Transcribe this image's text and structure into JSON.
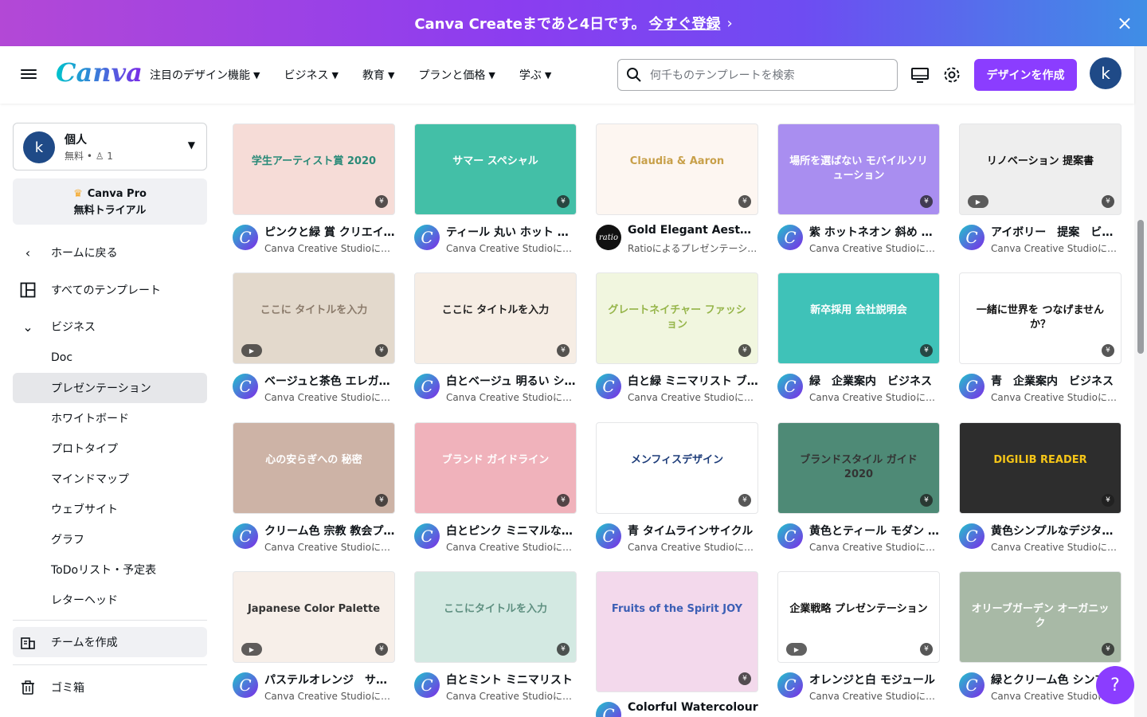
{
  "banner": {
    "text": "Canva Createまであと4日です。",
    "cta": "今すぐ登録",
    "chevron": "›",
    "close": "×"
  },
  "header": {
    "logo": "Canva",
    "nav": [
      {
        "label": "注目のデザイン機能"
      },
      {
        "label": "ビジネス"
      },
      {
        "label": "教育"
      },
      {
        "label": "プランと価格"
      },
      {
        "label": "学ぶ"
      }
    ],
    "search_placeholder": "何千ものテンプレートを検索",
    "create_button": "デザインを作成",
    "avatar_letter": "k"
  },
  "sidebar": {
    "account": {
      "avatar": "k",
      "name": "個人",
      "plan": "無料 • ♙ 1"
    },
    "pro": {
      "line1": "Canva Pro",
      "line2": "無料トライアル"
    },
    "back": "ホームに戻る",
    "all_templates": "すべてのテンプレート",
    "business": "ビジネス",
    "sub_items": [
      "Doc",
      "プレゼンテーション",
      "ホワイトボード",
      "プロトタイプ",
      "マインドマップ",
      "ウェブサイト",
      "グラフ",
      "ToDoリスト・予定表",
      "レターヘッド"
    ],
    "team": "チームを作成",
    "trash": "ゴミ箱"
  },
  "templates": [
    {
      "title": "ピンクと緑 賞 クリエイティブ",
      "by": "Canva Creative Studioによる",
      "thumb_text": "学生アーティスト賞 2020",
      "bg": "#f6dcd7",
      "fg": "#2a8a78",
      "video": false
    },
    {
      "title": "ティール 丸い ホット ネオン",
      "by": "Canva Creative Studioによる",
      "thumb_text": "サマー スペシャル",
      "bg": "#43bfa7",
      "fg": "#ffffff",
      "video": false
    },
    {
      "title": "Gold Elegant Aesthetic",
      "by": "Ratioによるプレゼンテーション",
      "thumb_text": "Claudia & Aaron",
      "bg": "#fdf6f1",
      "fg": "#c8a04a",
      "video": false
    },
    {
      "title": "紫 ホットネオン 斜め モバイル",
      "by": "Canva Creative Studioによる",
      "thumb_text": "場所を選ばない モバイルソリューション",
      "bg": "#a98ef0",
      "fg": "#ffffff",
      "video": false
    },
    {
      "title": "アイボリー　提案　ビジネス",
      "by": "Canva Creative Studioによる",
      "thumb_text": "リノベーション 提案書",
      "bg": "#eeeeee",
      "fg": "#111111",
      "video": true
    },
    {
      "title": "ベージュと茶色 エレガント",
      "by": "Canva Creative Studioによる",
      "thumb_text": "ここに タイトルを入力",
      "bg": "#e3d9cc",
      "fg": "#8a7a6a",
      "video": true
    },
    {
      "title": "白とベージュ 明るい シンプル",
      "by": "Canva Creative Studioによる",
      "thumb_text": "ここに タイトルを入力",
      "bg": "#f6ede4",
      "fg": "#222222",
      "video": false
    },
    {
      "title": "白と緑 ミニマリスト ブランド",
      "by": "Canva Creative Studioによる",
      "thumb_text": "グレートネイチャー ファッション",
      "bg": "#f1f6df",
      "fg": "#96b54a",
      "video": false
    },
    {
      "title": "緑　企業案内　ビジネス",
      "by": "Canva Creative Studioによる",
      "thumb_text": "新卒採用 会社説明会",
      "bg": "#3fc2b8",
      "fg": "#ffffff",
      "video": false
    },
    {
      "title": "青　企業案内　ビジネス",
      "by": "Canva Creative Studioによる",
      "thumb_text": "一緒に世界を つなげませんか？",
      "bg": "#ffffff",
      "fg": "#111111",
      "video": false
    },
    {
      "title": "クリーム色 宗教 教会プレゼン",
      "by": "Canva Creative Studioによる",
      "thumb_text": "心の安らぎへの 秘密",
      "bg": "#cdb3a6",
      "fg": "#ffffff",
      "video": false
    },
    {
      "title": "白とピンク ミニマルなブランド",
      "by": "Canva Creative Studioによる",
      "thumb_text": "ブランド ガイドライン",
      "bg": "#f0b2bb",
      "fg": "#ffffff",
      "video": false
    },
    {
      "title": "青 タイムラインサイクル",
      "by": "Canva Creative Studioによる",
      "thumb_text": "メンフィスデザイン",
      "bg": "#ffffff",
      "fg": "#1e3d7a",
      "video": false
    },
    {
      "title": "黄色とティール モダン ブランド",
      "by": "Canva Creative Studioによる",
      "thumb_text": "ブランドスタイル ガイド 2020",
      "bg": "#4e8a76",
      "fg": "#333333",
      "video": false
    },
    {
      "title": "黄色シンプルなデジタルリーダー",
      "by": "Canva Creative Studioによる",
      "thumb_text": "DIGILIB READER",
      "bg": "#2d2d2d",
      "fg": "#f5c518",
      "video": false
    },
    {
      "title": "パステルオレンジ　サーフ",
      "by": "Canva Creative Studioによる",
      "thumb_text": "Japanese Color Palette",
      "bg": "#f7efe9",
      "fg": "#333333",
      "video": true
    },
    {
      "title": "白とミント ミニマリスト",
      "by": "Canva Creative Studioによる",
      "thumb_text": "ここにタイトルを入力",
      "bg": "#d3e9e2",
      "fg": "#5e8f80",
      "video": false
    },
    {
      "title": "Colorful Watercolour",
      "by": "",
      "thumb_text": "Fruits of the Spirit JOY",
      "bg": "#f3d9ec",
      "fg": "#3c5fb5",
      "video": false
    },
    {
      "title": "オレンジと白 モジュール",
      "by": "Canva Creative Studioによる",
      "thumb_text": "企業戦略 プレゼンテーション",
      "bg": "#ffffff",
      "fg": "#111111",
      "video": true
    },
    {
      "title": "緑とクリーム色 シンプル",
      "by": "Canva Creative Studioによる",
      "thumb_text": "オリーブガーデン オーガニック",
      "bg": "#a8b9a6",
      "fg": "#ffffff",
      "video": false
    }
  ],
  "badges": {
    "premium": "¥",
    "play": "▶"
  },
  "help": "?"
}
